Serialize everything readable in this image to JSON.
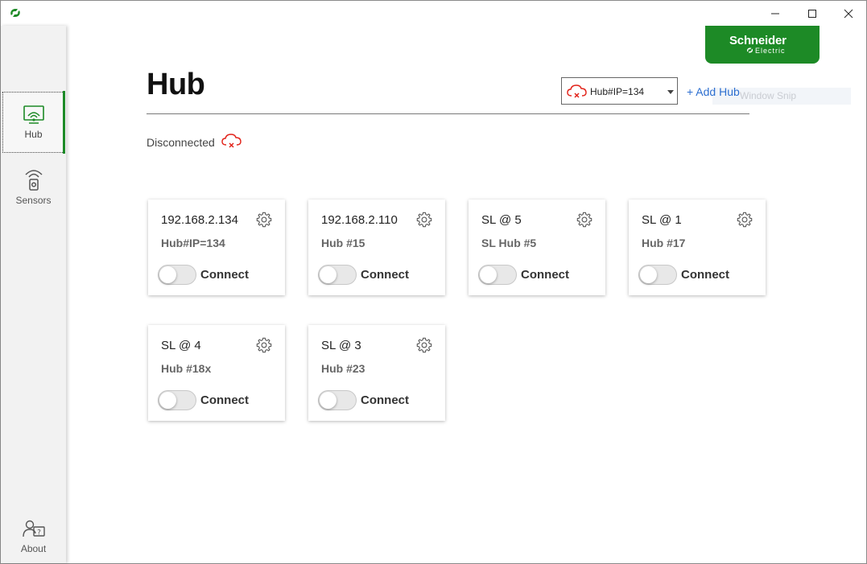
{
  "window": {
    "minimize_label": "—",
    "maximize_label": "□",
    "close_label": "✕"
  },
  "sidebar": {
    "items": [
      {
        "label": "Hub",
        "icon": "hub-wifi-icon",
        "active": true
      },
      {
        "label": "Sensors",
        "icon": "sensor-icon",
        "active": false
      },
      {
        "label": "About",
        "icon": "about-user-icon",
        "active": false
      }
    ]
  },
  "brand": {
    "name": "Schneider",
    "sub": "Electric",
    "color": "#1d8a26"
  },
  "header": {
    "title": "Hub",
    "selected_hub": "Hub#IP=134",
    "add_hub_label": "+ Add Hub",
    "overlay_text": "Window Snip"
  },
  "status": {
    "label": "Disconnected",
    "icon": "cloud-disconnected-icon",
    "color": "#e2231a"
  },
  "cards": [
    {
      "title": "192.168.2.134",
      "subtitle": "Hub#IP=134",
      "toggle_label": "Connect",
      "connected": false
    },
    {
      "title": "192.168.2.110",
      "subtitle": "Hub #15",
      "toggle_label": "Connect",
      "connected": false
    },
    {
      "title": "SL @ 5",
      "subtitle": "SL Hub #5",
      "toggle_label": "Connect",
      "connected": false
    },
    {
      "title": "SL @ 1",
      "subtitle": "Hub #17",
      "toggle_label": "Connect",
      "connected": false
    },
    {
      "title": "SL @ 4",
      "subtitle": "Hub #18x",
      "toggle_label": "Connect",
      "connected": false
    },
    {
      "title": "SL @ 3",
      "subtitle": "Hub #23",
      "toggle_label": "Connect",
      "connected": false
    }
  ]
}
